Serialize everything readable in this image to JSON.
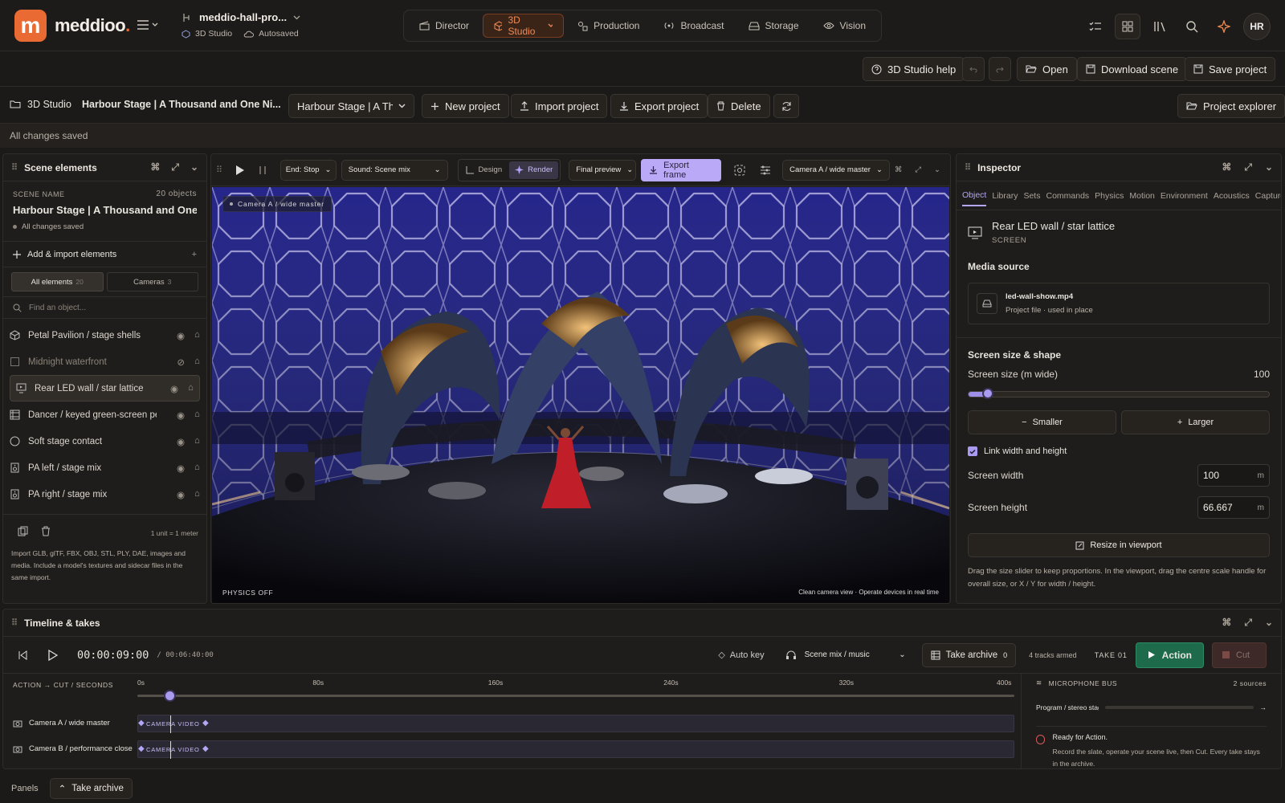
{
  "app": {
    "brand": "meddioo",
    "brand_dot": ".",
    "logo_letter": "m",
    "project_path": "meddio-hall-pro...",
    "sub1": "3D Studio",
    "sub2": "Autosaved",
    "avatar": "HR"
  },
  "nav": [
    {
      "label": "Director"
    },
    {
      "label": "3D Studio"
    },
    {
      "label": "Production"
    },
    {
      "label": "Broadcast"
    },
    {
      "label": "Storage"
    },
    {
      "label": "Vision"
    }
  ],
  "bar2": {
    "help": "3D Studio help",
    "open": "Open",
    "download": "Download scene",
    "save": "Save project"
  },
  "bar3": {
    "section": "3D Studio",
    "project_title": "Harbour Stage | A Thousand and One Ni...",
    "project_select": "Harbour Stage | A Thous",
    "new": "New project",
    "import": "Import project",
    "export": "Export project",
    "delete": "Delete",
    "explorer": "Project explorer"
  },
  "status": "All changes saved",
  "scene": {
    "panel_title": "Scene elements",
    "name_label": "SCENE NAME",
    "count": "20 objects",
    "name": "Harbour Stage | A Thousand and One ...",
    "saved": "All changes saved",
    "add": "Add & import elements",
    "tab_all": "All elements",
    "tab_all_count": "20",
    "tab_cams": "Cameras",
    "tab_cams_count": "3",
    "search_placeholder": "Find an object...",
    "objects": [
      {
        "name": "Petal Pavilion / stage shells",
        "icon": "cube-icon"
      },
      {
        "name": "Midnight waterfront",
        "icon": "square-icon"
      },
      {
        "name": "Rear LED wall / star lattice",
        "icon": "screen-icon"
      },
      {
        "name": "Dancer / keyed green-screen pe...",
        "icon": "film-icon"
      },
      {
        "name": "Soft stage contact",
        "icon": "circle-icon"
      },
      {
        "name": "PA left / stage mix",
        "icon": "speaker-icon"
      },
      {
        "name": "PA right / stage mix",
        "icon": "speaker-icon"
      }
    ],
    "unit": "1 unit = 1 meter",
    "hint": "Import GLB, glTF, FBX, OBJ, STL, PLY, DAE, images and media. Include a model's textures and sidecar files in the same import."
  },
  "viewport": {
    "end": "End: Stop",
    "sound": "Sound: Scene mix",
    "design": "Design",
    "render": "Render",
    "preview": "Final preview",
    "export": "Export frame",
    "camera": "Camera A / wide master",
    "overlay_cam": "Camera A / wide master",
    "physics": "PHYSICS OFF",
    "footer": "Clean camera view · Operate devices in real time"
  },
  "inspector": {
    "title": "Inspector",
    "tabs": [
      "Object",
      "Library",
      "Sets",
      "Commands",
      "Physics",
      "Motion",
      "Environment",
      "Acoustics",
      "Capture"
    ],
    "obj_name": "Rear LED wall / star lattice",
    "obj_type": "SCREEN",
    "media_heading": "Media source",
    "file": "led-wall-show.mp4",
    "file_sub": "Project file · used in place",
    "size_heading": "Screen size & shape",
    "size_label": "Screen size (m wide)",
    "size_value": "100",
    "size_fraction": 0.045,
    "smaller": "Smaller",
    "larger": "Larger",
    "link": "Link width and height",
    "width_label": "Screen width",
    "width": "100",
    "height_label": "Screen height",
    "height": "66.667",
    "unit": "m",
    "resize": "Resize in viewport",
    "help": "Drag the size slider to keep proportions. In the viewport, drag the centre scale handle for overall size, or X / Y for width / height."
  },
  "timeline": {
    "title": "Timeline & takes",
    "time": "00:00:09:00",
    "total": "/ 00:06:40:00",
    "autokey": "Auto key",
    "mix": "Scene mix / music",
    "archive": "Take archive",
    "archive_count": "0",
    "armed": "4 tracks armed",
    "take": "TAKE 01",
    "action": "Action",
    "cut": "Cut",
    "ruler_label": "ACTION → CUT / SECONDS",
    "ticks": [
      "0s",
      "80s",
      "160s",
      "240s",
      "320s",
      "400s"
    ],
    "playhead_fraction": 0.03,
    "tracks": [
      {
        "name": "Camera A / wide master",
        "clip": "CAMERA VIDEO"
      },
      {
        "name": "Camera B / performance close",
        "clip": "CAMERA VIDEO"
      }
    ],
    "mic_title": "MICROPHONE BUS",
    "mic_count": "2 sources",
    "mic_row": "Program / stereo stage...",
    "ready": "Ready for Action.",
    "ready_sub": "Record the slate, operate your scene live, then Cut. Every take stays in the archive."
  },
  "bottom": {
    "panels": "Panels",
    "archive": "Take archive"
  },
  "colors": {
    "accent": "#e96a32",
    "violet": "#b3a7f5",
    "green": "#1d6b4b"
  }
}
